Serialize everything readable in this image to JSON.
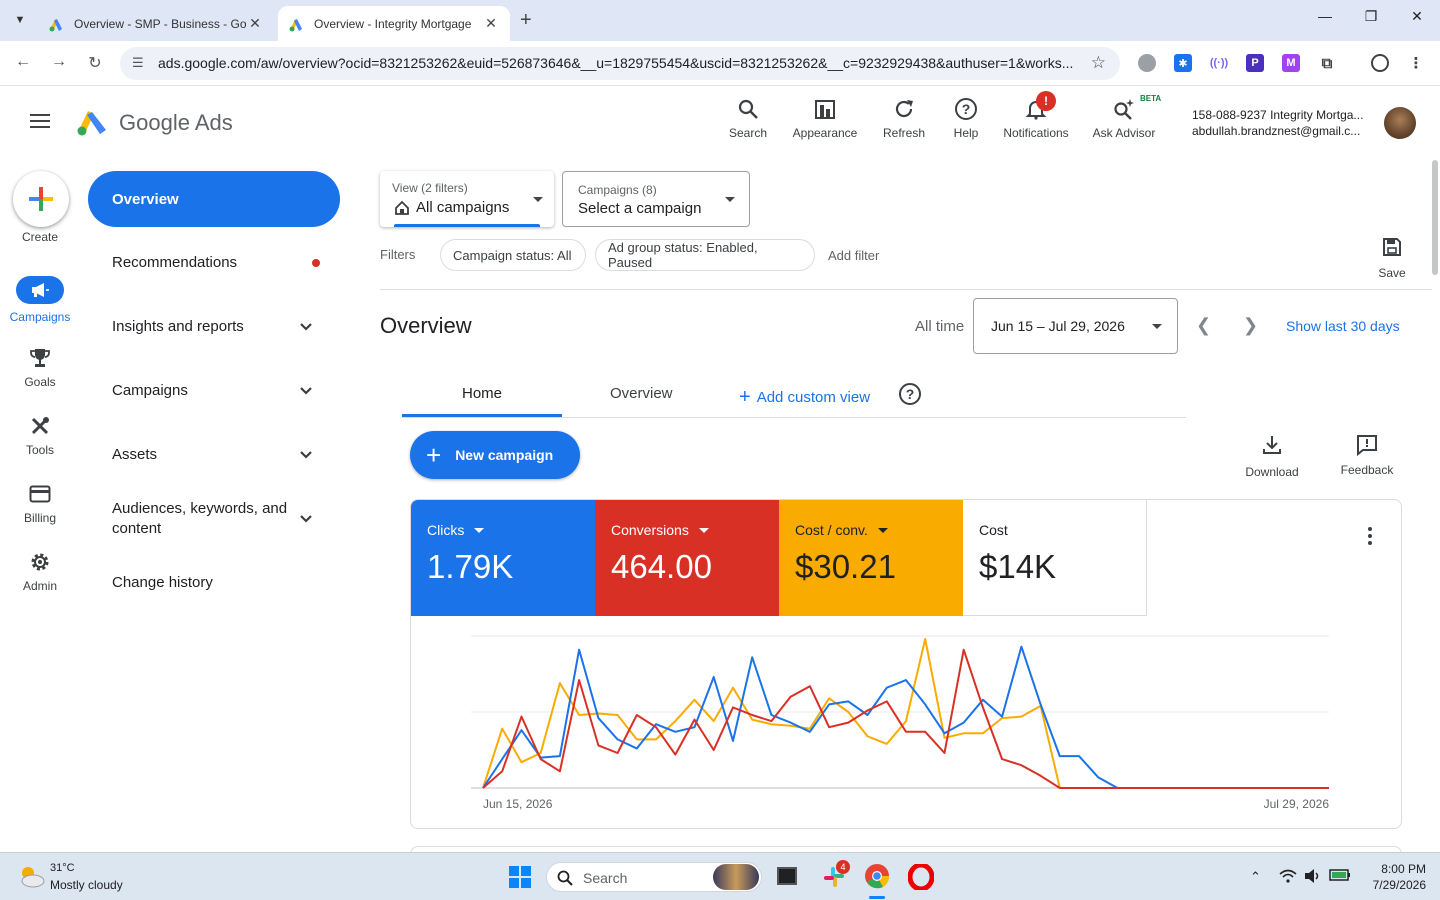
{
  "browser": {
    "tabs": [
      {
        "title": "Overview - SMP - Business - Go",
        "active": false
      },
      {
        "title": "Overview - Integrity Mortgage",
        "active": true
      }
    ],
    "url": "ads.google.com/aw/overview?ocid=8321253262&euid=526873646&__u=1829755454&uscid=8321253262&__c=9232929438&authuser=1&works..."
  },
  "header": {
    "app_name": "Google Ads",
    "buttons": {
      "search": "Search",
      "appearance": "Appearance",
      "refresh": "Refresh",
      "help": "Help",
      "notifications": "Notifications",
      "ask_advisor": "Ask Advisor"
    },
    "notification_count": "!",
    "beta": "BETA",
    "account_line1": "158-088-9237 Integrity Mortga...",
    "account_line2": "abdullah.brandznest@gmail.c..."
  },
  "rail": {
    "create": "Create",
    "campaigns": "Campaigns",
    "goals": "Goals",
    "tools": "Tools",
    "billing": "Billing",
    "admin": "Admin"
  },
  "nav": {
    "overview": "Overview",
    "recommendations": "Recommendations",
    "insights": "Insights and reports",
    "campaigns": "Campaigns",
    "assets": "Assets",
    "audiences": "Audiences, keywords, and content",
    "change_history": "Change history"
  },
  "filters": {
    "view_label": "View (2 filters)",
    "view_value": "All campaigns",
    "campaigns_label": "Campaigns (8)",
    "campaigns_value": "Select a campaign",
    "filters_label": "Filters",
    "chip1": "Campaign status: All",
    "chip2": "Ad group status: Enabled, Paused",
    "add_filter": "Add filter",
    "save": "Save"
  },
  "overview": {
    "title": "Overview",
    "all_time": "All time",
    "date_range": "Jun 15 – Jul 29, 2026",
    "show_last": "Show last 30 days",
    "tab_home": "Home",
    "tab_overview": "Overview",
    "add_custom_view": "Add custom view",
    "new_campaign": "New campaign",
    "download": "Download",
    "feedback": "Feedback"
  },
  "metrics": [
    {
      "name": "Clicks",
      "value": "1.79K",
      "color": "#1a73e8"
    },
    {
      "name": "Conversions",
      "value": "464.00",
      "color": "#d93025"
    },
    {
      "name": "Cost / conv.",
      "value": "$30.21",
      "color": "#f9ab00"
    },
    {
      "name": "Cost",
      "value": "$14K",
      "color": "#ffffff"
    }
  ],
  "chart_data": {
    "type": "line",
    "x_start_label": "Jun 15, 2026",
    "x_end_label": "Jul 29, 2026",
    "grid": true,
    "ylim": [
      0,
      1
    ],
    "series": [
      {
        "name": "Clicks",
        "color": "#1a73e8",
        "values": [
          0.0,
          0.19,
          0.38,
          0.2,
          0.21,
          0.91,
          0.46,
          0.32,
          0.26,
          0.42,
          0.37,
          0.4,
          0.73,
          0.31,
          0.86,
          0.48,
          0.43,
          0.37,
          0.55,
          0.57,
          0.48,
          0.66,
          0.71,
          0.55,
          0.36,
          0.43,
          0.58,
          0.47,
          0.93,
          0.55,
          0.21,
          0.21,
          0.07,
          0.0,
          0.0,
          0.0,
          0.0,
          0.0,
          0.0,
          0.0,
          0.0,
          0.0,
          0.0,
          0.0,
          0.0
        ]
      },
      {
        "name": "Conversions",
        "color": "#d93025",
        "values": [
          0.0,
          0.11,
          0.47,
          0.19,
          0.11,
          0.71,
          0.28,
          0.23,
          0.48,
          0.4,
          0.22,
          0.45,
          0.25,
          0.53,
          0.48,
          0.44,
          0.6,
          0.67,
          0.4,
          0.43,
          0.51,
          0.57,
          0.37,
          0.37,
          0.23,
          0.91,
          0.53,
          0.19,
          0.15,
          0.08,
          0.0,
          0.0,
          0.0,
          0.0,
          0.0,
          0.0,
          0.0,
          0.0,
          0.0,
          0.0,
          0.0,
          0.0,
          0.0,
          0.0,
          0.0
        ]
      },
      {
        "name": "Cost / conv.",
        "color": "#f9ab00",
        "values": [
          0.0,
          0.39,
          0.17,
          0.23,
          0.69,
          0.48,
          0.49,
          0.48,
          0.32,
          0.32,
          0.44,
          0.58,
          0.44,
          0.66,
          0.45,
          0.42,
          0.41,
          0.39,
          0.59,
          0.5,
          0.34,
          0.29,
          0.44,
          0.98,
          0.33,
          0.36,
          0.36,
          0.46,
          0.47,
          0.54,
          0.0,
          0.0,
          0.0,
          0.0,
          0.0,
          0.0,
          0.0,
          0.0,
          0.0,
          0.0,
          0.0,
          0.0,
          0.0,
          0.0,
          0.0
        ]
      }
    ]
  },
  "taskbar": {
    "temp": "31°C",
    "weather": "Mostly cloudy",
    "search": "Search",
    "time": "8:00 PM",
    "date": "7/29/2026",
    "slack_badge": "4"
  }
}
